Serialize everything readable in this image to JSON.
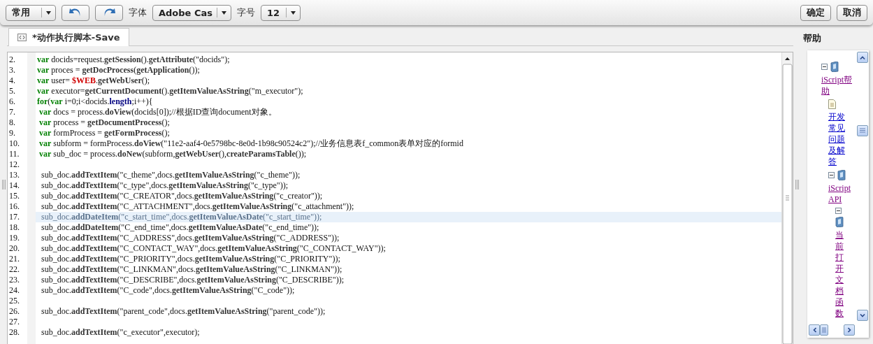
{
  "toolbar": {
    "items": [
      {
        "kind": "dropdown",
        "value": "常用"
      },
      {
        "kind": "undo"
      },
      {
        "kind": "redo"
      },
      {
        "kind": "label",
        "text": "字体"
      },
      {
        "kind": "dropdown",
        "value": "Adobe Cas"
      },
      {
        "kind": "label",
        "text": "字号"
      },
      {
        "kind": "dropdown",
        "value": "12"
      }
    ],
    "buttons": [
      "确定",
      "取消"
    ]
  },
  "tabs": [
    {
      "label": "*动作执行脚本-Save",
      "selected": true
    }
  ],
  "editor": {
    "lines": [
      {
        "number": "2.",
        "selected": false,
        "tokens": [
          {
            "kind": "kw",
            "text": "var"
          },
          {
            "kind": "t",
            "text": " docids=request."
          },
          {
            "kind": "fn",
            "text": "getSession"
          },
          {
            "kind": "t",
            "text": "()."
          },
          {
            "kind": "fn",
            "text": "getAttribute"
          },
          {
            "kind": "t",
            "text": "(\"docids\");"
          }
        ]
      },
      {
        "number": "3.",
        "selected": false,
        "tokens": [
          {
            "kind": "kw",
            "text": "var"
          },
          {
            "kind": "t",
            "text": " proces = "
          },
          {
            "kind": "fn",
            "text": "getDocProcess"
          },
          {
            "kind": "t",
            "text": "("
          },
          {
            "kind": "fn",
            "text": "getApplication"
          },
          {
            "kind": "t",
            "text": "());"
          }
        ]
      },
      {
        "number": "4.",
        "selected": false,
        "tokens": [
          {
            "kind": "kw",
            "text": "var"
          },
          {
            "kind": "t",
            "text": " user= "
          },
          {
            "kind": "red",
            "text": "$WEB"
          },
          {
            "kind": "t",
            "text": "."
          },
          {
            "kind": "fn",
            "text": "getWebUser"
          },
          {
            "kind": "t",
            "text": "();"
          }
        ]
      },
      {
        "number": "5.",
        "selected": false,
        "tokens": [
          {
            "kind": "kw",
            "text": "var"
          },
          {
            "kind": "t",
            "text": " executor="
          },
          {
            "kind": "fn",
            "text": "getCurrentDocument"
          },
          {
            "kind": "t",
            "text": "()."
          },
          {
            "kind": "fn",
            "text": "getItemValueAsString"
          },
          {
            "kind": "t",
            "text": "(\"m_executor\");"
          }
        ]
      },
      {
        "number": "6.",
        "selected": false,
        "tokens": [
          {
            "kind": "kw",
            "text": "for"
          },
          {
            "kind": "t",
            "text": "("
          },
          {
            "kind": "kw",
            "text": "var"
          },
          {
            "kind": "t",
            "text": " i=0;i<docids."
          },
          {
            "kind": "prop",
            "text": "length"
          },
          {
            "kind": "t",
            "text": ";i++){"
          }
        ]
      },
      {
        "number": "7.",
        "selected": false,
        "tokens": [
          {
            "kind": "kw",
            "text": " var"
          },
          {
            "kind": "t",
            "text": " docs = process."
          },
          {
            "kind": "fn",
            "text": "doView"
          },
          {
            "kind": "t",
            "text": "(docids[0]);//根据ID查询document对象。"
          }
        ]
      },
      {
        "number": "8.",
        "selected": false,
        "tokens": [
          {
            "kind": "kw",
            "text": " var"
          },
          {
            "kind": "t",
            "text": " process = "
          },
          {
            "kind": "fn",
            "text": "getDocumentProcess"
          },
          {
            "kind": "t",
            "text": "();"
          }
        ]
      },
      {
        "number": "9.",
        "selected": false,
        "tokens": [
          {
            "kind": "kw",
            "text": " var"
          },
          {
            "kind": "t",
            "text": " formProcess = "
          },
          {
            "kind": "fn",
            "text": "getFormProcess"
          },
          {
            "kind": "t",
            "text": "();"
          }
        ]
      },
      {
        "number": "10.",
        "selected": false,
        "tokens": [
          {
            "kind": "kw",
            "text": " var"
          },
          {
            "kind": "t",
            "text": " subform = formProcess."
          },
          {
            "kind": "fn",
            "text": "doView"
          },
          {
            "kind": "t",
            "text": "(\"11e2-aaf4-0e5798bc-8e0d-1b98c90524c2\");//业务信息表f_common表单对应的formid"
          }
        ]
      },
      {
        "number": "11.",
        "selected": false,
        "tokens": [
          {
            "kind": "kw",
            "text": " var"
          },
          {
            "kind": "t",
            "text": " sub_doc = process."
          },
          {
            "kind": "fn",
            "text": "doNew"
          },
          {
            "kind": "t",
            "text": "(subform,"
          },
          {
            "kind": "fn",
            "text": "getWebUser"
          },
          {
            "kind": "t",
            "text": "(),"
          },
          {
            "kind": "fn",
            "text": "createParamsTable"
          },
          {
            "kind": "t",
            "text": "());"
          }
        ]
      },
      {
        "number": "12.",
        "selected": false
      },
      {
        "number": "13.",
        "selected": false,
        "tokens": [
          {
            "kind": "t",
            "text": "  sub_doc."
          },
          {
            "kind": "fn",
            "text": "addTextItem"
          },
          {
            "kind": "t",
            "text": "(\"c_theme\",docs."
          },
          {
            "kind": "fn",
            "text": "getItemValueAsString"
          },
          {
            "kind": "t",
            "text": "(\"c_theme\"));"
          }
        ]
      },
      {
        "number": "14.",
        "selected": false,
        "tokens": [
          {
            "kind": "t",
            "text": "  sub_doc."
          },
          {
            "kind": "fn",
            "text": "addTextItem"
          },
          {
            "kind": "t",
            "text": "(\"c_type\",docs."
          },
          {
            "kind": "fn",
            "text": "getItemValueAsString"
          },
          {
            "kind": "t",
            "text": "(\"c_type\"));"
          }
        ]
      },
      {
        "number": "15.",
        "selected": false,
        "tokens": [
          {
            "kind": "t",
            "text": "  sub_doc."
          },
          {
            "kind": "fn",
            "text": "addTextItem"
          },
          {
            "kind": "t",
            "text": "(\"C_CREATOR\",docs."
          },
          {
            "kind": "fn",
            "text": "getItemValueAsString"
          },
          {
            "kind": "t",
            "text": "(\"c_creator\"));"
          }
        ]
      },
      {
        "number": "16.",
        "selected": false,
        "tokens": [
          {
            "kind": "t",
            "text": "  sub_doc."
          },
          {
            "kind": "fn",
            "text": "addTextItem"
          },
          {
            "kind": "t",
            "text": "(\"C_ATTACHMENT\",docs."
          },
          {
            "kind": "fn",
            "text": "getItemValueAsString"
          },
          {
            "kind": "t",
            "text": "(\"c_attachment\"));"
          }
        ]
      },
      {
        "number": "17.",
        "selected": true,
        "tokens": [
          {
            "kind": "t",
            "text": "  sub_doc."
          },
          {
            "kind": "fn",
            "text": "addDateItem"
          },
          {
            "kind": "t",
            "text": "(\"c_start_time\",docs."
          },
          {
            "kind": "fn",
            "text": "getItemValueAsDate"
          },
          {
            "kind": "t",
            "text": "(\"c_start_time\"));"
          }
        ]
      },
      {
        "number": "18.",
        "selected": false,
        "tokens": [
          {
            "kind": "t",
            "text": "  sub_doc."
          },
          {
            "kind": "fn",
            "text": "addDateItem"
          },
          {
            "kind": "t",
            "text": "(\"C_end_time\",docs."
          },
          {
            "kind": "fn",
            "text": "getItemValueAsDate"
          },
          {
            "kind": "t",
            "text": "(\"c_end_time\"));"
          }
        ]
      },
      {
        "number": "19.",
        "selected": false,
        "tokens": [
          {
            "kind": "t",
            "text": "  sub_doc."
          },
          {
            "kind": "fn",
            "text": "addTextItem"
          },
          {
            "kind": "t",
            "text": "(\"C_ADDRESS\",docs."
          },
          {
            "kind": "fn",
            "text": "getItemValueAsString"
          },
          {
            "kind": "t",
            "text": "(\"C_ADDRESS\"));"
          }
        ]
      },
      {
        "number": "20.",
        "selected": false,
        "tokens": [
          {
            "kind": "t",
            "text": "  sub_doc."
          },
          {
            "kind": "fn",
            "text": "addTextItem"
          },
          {
            "kind": "t",
            "text": "(\"C_CONTACT_WAY\",docs."
          },
          {
            "kind": "fn",
            "text": "getItemValueAsString"
          },
          {
            "kind": "t",
            "text": "(\"C_CONTACT_WAY\"));"
          }
        ]
      },
      {
        "number": "21.",
        "selected": false,
        "tokens": [
          {
            "kind": "t",
            "text": "  sub_doc."
          },
          {
            "kind": "fn",
            "text": "addTextItem"
          },
          {
            "kind": "t",
            "text": "(\"C_PRIORITY\",docs."
          },
          {
            "kind": "fn",
            "text": "getItemValueAsString"
          },
          {
            "kind": "t",
            "text": "(\"C_PRIORITY\"));"
          }
        ]
      },
      {
        "number": "22.",
        "selected": false,
        "tokens": [
          {
            "kind": "t",
            "text": "  sub_doc."
          },
          {
            "kind": "fn",
            "text": "addTextItem"
          },
          {
            "kind": "t",
            "text": "(\"C_LINKMAN\",docs."
          },
          {
            "kind": "fn",
            "text": "getItemValueAsString"
          },
          {
            "kind": "t",
            "text": "(\"C_LINKMAN\"));"
          }
        ]
      },
      {
        "number": "23.",
        "selected": false,
        "tokens": [
          {
            "kind": "t",
            "text": "  sub_doc."
          },
          {
            "kind": "fn",
            "text": "addTextItem"
          },
          {
            "kind": "t",
            "text": "(\"C_DESCRIBE\",docs."
          },
          {
            "kind": "fn",
            "text": "getItemValueAsString"
          },
          {
            "kind": "t",
            "text": "(\"C_DESCRIBE\"));"
          }
        ]
      },
      {
        "number": "24.",
        "selected": false,
        "tokens": [
          {
            "kind": "t",
            "text": "  sub_doc."
          },
          {
            "kind": "fn",
            "text": "addTextItem"
          },
          {
            "kind": "t",
            "text": "(\"C_code\",docs."
          },
          {
            "kind": "fn",
            "text": "getItemValueAsString"
          },
          {
            "kind": "t",
            "text": "(\"C_code\"));"
          }
        ]
      },
      {
        "number": "25.",
        "selected": false
      },
      {
        "number": "26.",
        "selected": false,
        "tokens": [
          {
            "kind": "t",
            "text": "  sub_doc."
          },
          {
            "kind": "fn",
            "text": "addTextItem"
          },
          {
            "kind": "t",
            "text": "(\"parent_code\",docs."
          },
          {
            "kind": "fn",
            "text": "getItemValueAsString"
          },
          {
            "kind": "t",
            "text": "(\"parent_code\"));"
          }
        ]
      },
      {
        "number": "27.",
        "selected": false
      },
      {
        "number": "28.",
        "selected": false,
        "tokens": [
          {
            "kind": "t",
            "text": "  sub_doc."
          },
          {
            "kind": "fn",
            "text": "addTextItem"
          },
          {
            "kind": "t",
            "text": "(\"c_executor\",executor);"
          }
        ]
      }
    ]
  },
  "help": {
    "title": "帮助",
    "tree": [
      {
        "label": "iScript帮助",
        "kind": "book",
        "expanded": true,
        "visited": true,
        "children": [
          {
            "label": "开发常见问题及解答",
            "kind": "page",
            "visited": false
          },
          {
            "label": "iScript API",
            "kind": "book",
            "expanded": true,
            "visited": true,
            "children": [
              {
                "label": "当前打开文档函数",
                "kind": "book",
                "expanded": true,
                "visited": true
              }
            ]
          }
        ]
      }
    ]
  }
}
